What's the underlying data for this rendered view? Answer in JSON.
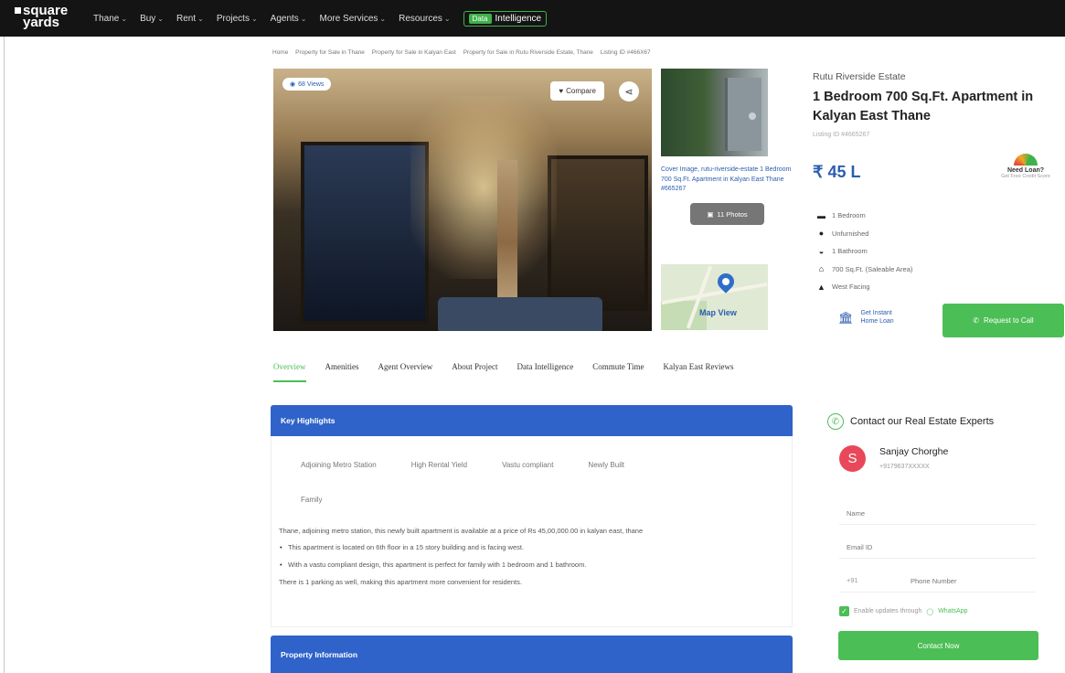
{
  "nav": {
    "logo_line1": "square",
    "logo_line2": "yards",
    "items": [
      "Thane",
      "Buy",
      "Rent",
      "Projects",
      "Agents",
      "More Services",
      "Resources"
    ],
    "di_badge": "Data",
    "di_label": "Intelligence"
  },
  "breadcrumb": [
    "Home",
    "Property for Sale in Thane",
    "Property for Sale in Kalyan East",
    "Property for Sale in Rutu Riverside Estate, Thane",
    "Listing ID #466X67"
  ],
  "gallery": {
    "views": "68 Views",
    "compare": "Compare",
    "cover_alt": "Cover Image, rutu-riverside-estate 1 Bedroom 700 Sq.Ft. Apartment in Kalyan East Thane #665267",
    "photos_label": "11 Photos",
    "map_label": "Map View"
  },
  "listing": {
    "project_name": "Rutu Riverside Estate",
    "title": "1 Bedroom 700 Sq.Ft. Apartment in Kalyan East Thane",
    "listing_id": "Listing ID #4665267",
    "price": "₹ 45 L",
    "need_loan": "Need Loan?",
    "credit_score": "Get Free Credit Score",
    "features": [
      {
        "icon": "bed-icon",
        "glyph": "▬",
        "text": "1 Bedroom"
      },
      {
        "icon": "furnishing-icon",
        "glyph": "●",
        "text": "Unfurnished"
      },
      {
        "icon": "bathtub-icon",
        "glyph": "◒",
        "text": "1 Bathroom"
      },
      {
        "icon": "home-icon",
        "glyph": "⌂",
        "text": "700 Sq.Ft. (Saleable Area)"
      },
      {
        "icon": "compass-icon",
        "glyph": "▲",
        "text": "West Facing"
      }
    ],
    "home_loan_line1": "Get Instant",
    "home_loan_line2": "Home Loan",
    "request_call": "Request to Call"
  },
  "tabs": [
    "Overview",
    "Amenities",
    "Agent Overview",
    "About Project",
    "Data Intelligence",
    "Commute Time",
    "Kalyan East Reviews"
  ],
  "highlights": {
    "header": "Key Highlights",
    "tags": [
      "Adjoining Metro Station",
      "High Rental Yield",
      "Vastu compliant",
      "Newly Built"
    ],
    "tags_row2": "Family",
    "description_1": "Thane, adjoining metro station, this newly built apartment is available at a price of Rs 45,00,000.00 in kalyan east, thane",
    "bullets": [
      "This apartment is located on 6th floor in a 15 story building and is facing west.",
      "With a vastu compliant design, this apartment is perfect for family with 1 bedroom and 1 bathroom."
    ],
    "description_2": "There is 1 parking as well, making this apartment more convenient for residents."
  },
  "property_info": {
    "header": "Property Information"
  },
  "contact": {
    "title": "Contact our Real Estate Experts",
    "agent_initial": "S",
    "agent_name": "Sanjay Chorghe",
    "agent_phone": "+9179637XXXXX",
    "name_placeholder": "Name",
    "email_placeholder": "Email ID",
    "country_code": "+91",
    "phone_placeholder": "Phone Number",
    "whatsapp_text": "Enable updates through",
    "whatsapp_link": "WhatsApp",
    "submit": "Contact Now"
  },
  "colors": {
    "brand_blue": "#2f63c9",
    "green": "#4cbe56",
    "nav_bg": "#141414"
  }
}
